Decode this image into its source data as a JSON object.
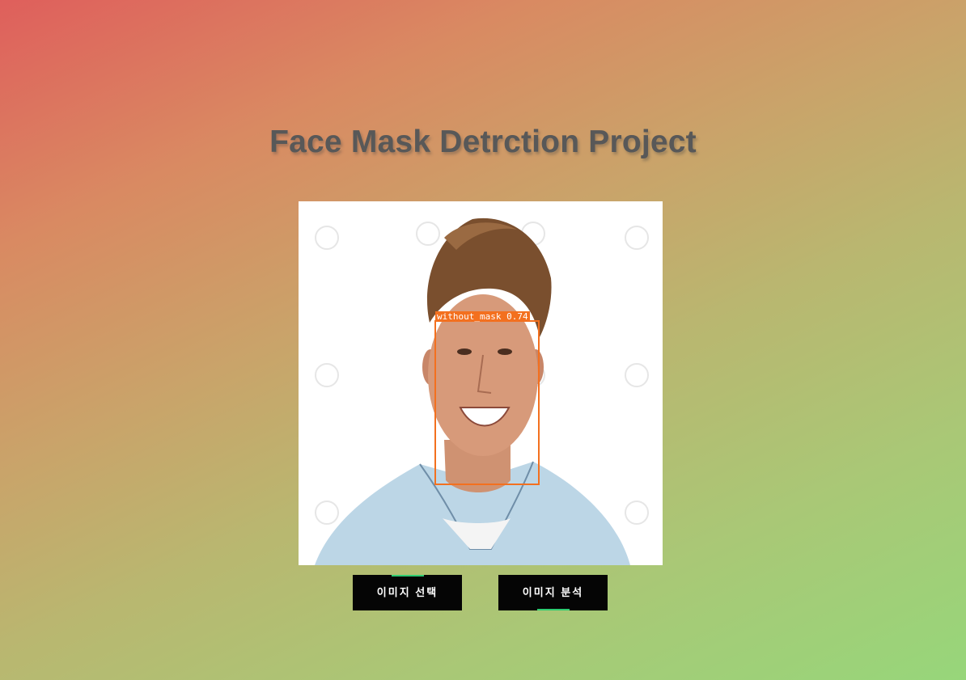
{
  "page": {
    "title": "Face Mask Detrction Project"
  },
  "result_image": {
    "detection_label": "without_mask 0.74",
    "box_color": "#f3701f"
  },
  "buttons": {
    "select_label": "이미지 선택",
    "analyze_label": "이미지 분석"
  },
  "colors": {
    "button_bg": "#050505",
    "button_accent": "#2ecc71",
    "title": "#585858"
  }
}
